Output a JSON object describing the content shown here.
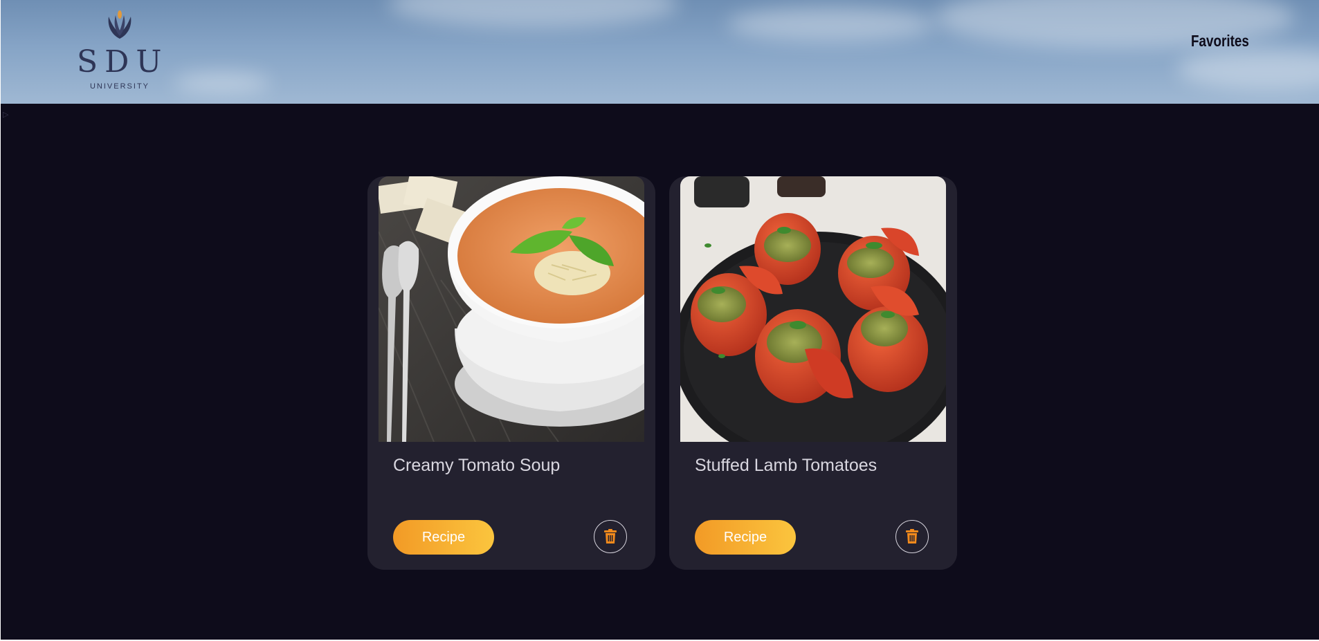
{
  "header": {
    "logo": {
      "letters": "SDU",
      "subtitle": "UNIVERSITY",
      "icon": "university-crest-icon"
    },
    "nav": {
      "favorites_label": "Favorites"
    }
  },
  "colors": {
    "background": "#0e0c1b",
    "card": "#23212f",
    "accent_start": "#f29a26",
    "accent_end": "#fbc53e",
    "text": "#d9d7e0"
  },
  "favorites": [
    {
      "title": "Creamy Tomato Soup",
      "image": "creamy-tomato-soup-photo",
      "recipe_label": "Recipe",
      "delete_icon": "trash-icon"
    },
    {
      "title": "Stuffed Lamb Tomatoes",
      "image": "stuffed-lamb-tomatoes-photo",
      "recipe_label": "Recipe",
      "delete_icon": "trash-icon"
    }
  ]
}
